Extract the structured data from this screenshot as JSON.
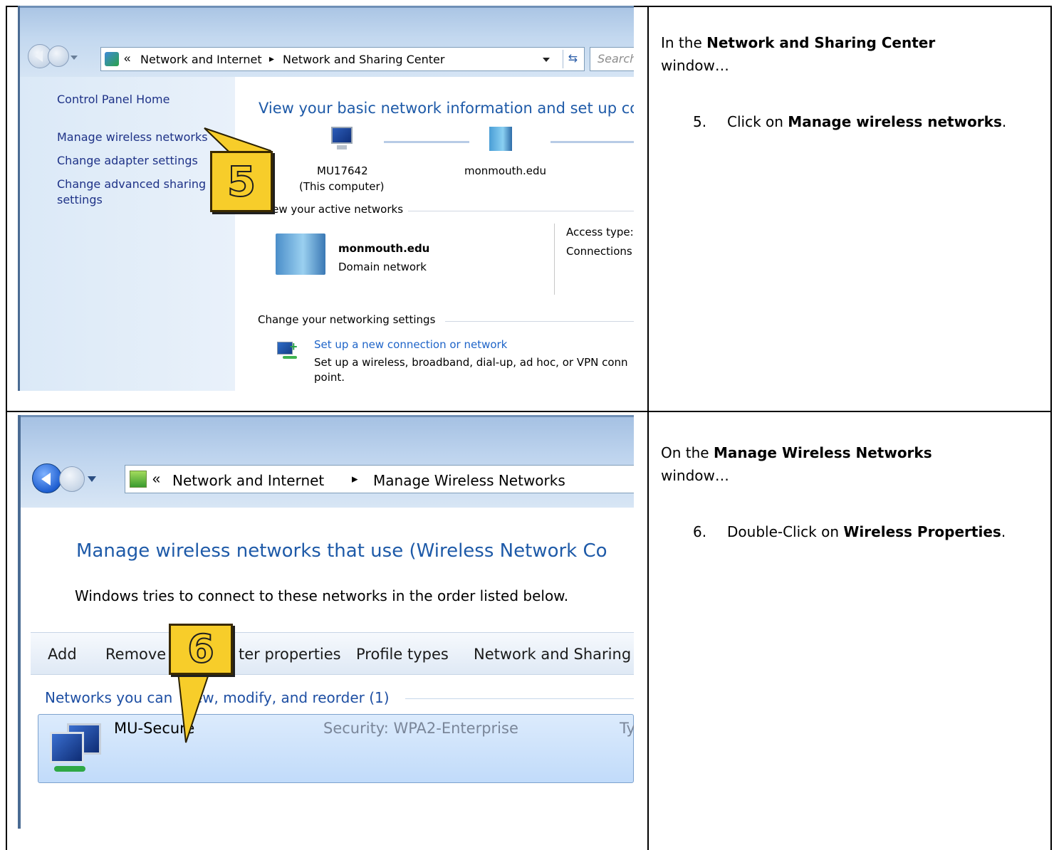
{
  "step5": {
    "window": {
      "address_root": "«",
      "crumb1": "Network and Internet",
      "crumb_sep": "▸",
      "crumb2": "Network and Sharing Center",
      "search_placeholder": "Search"
    },
    "sidebar": {
      "items": [
        {
          "label": "Control Panel Home"
        },
        {
          "label": "Manage wireless networks"
        },
        {
          "label": "Change adapter settings"
        },
        {
          "label": "Change advanced sharing"
        },
        {
          "label": "settings"
        }
      ]
    },
    "main": {
      "heading": "View your basic network information and set up con",
      "computer_name": "MU17642",
      "computer_sub": "(This computer)",
      "domain_name": "monmouth.edu",
      "active_networks_label": "iew your active networks",
      "network_name": "monmouth.edu",
      "network_type": "Domain network",
      "access_type_label": "Access type:",
      "connections_label": "Connections",
      "change_settings_label": "Change your networking settings",
      "setup_link": "Set up a new connection or network",
      "setup_desc_line1": "Set up a wireless, broadband, dial-up, ad hoc, or VPN conn",
      "setup_desc_line2": "point."
    },
    "badge": "5",
    "instructions": {
      "intro_before": "In the ",
      "intro_bold": "Network and Sharing Center",
      "intro_after": "window…",
      "step_number": "5.",
      "step_before": "Click on ",
      "step_bold": "Manage wireless networks",
      "step_after": "."
    }
  },
  "step6": {
    "window": {
      "address_root": "«",
      "crumb1": "Network and Internet",
      "crumb_sep": "▸",
      "crumb2": "Manage Wireless Networks"
    },
    "main": {
      "heading": "Manage wireless networks that use (Wireless Network Co",
      "subtitle": "Windows tries to connect to these networks in the order listed below.",
      "toolbar": [
        "Add",
        "Remove",
        "ter properties",
        "Profile types",
        "Network and Sharing"
      ],
      "group_label": "Networks you can view, modify, and reorder (1)",
      "group_label_visible_a": "Networks you can",
      "group_label_visible_b": "iew, modify, and reorder (1)",
      "network_name": "MU-Secure",
      "security": "Security:  WPA2-Enterprise",
      "type_fragment": "Ty"
    },
    "badge": "6",
    "instructions": {
      "intro_before": "On the ",
      "intro_bold": "Manage Wireless Networks",
      "intro_after": "window…",
      "step_number": "6.",
      "step_before": "Double-Click on ",
      "step_bold": "Wireless Properties",
      "step_after": "."
    }
  },
  "colors": {
    "badge_fill": "#f7cd2a",
    "link_blue": "#1e64c8",
    "heading_blue": "#1e5aa8",
    "chrome_blue": "#bcd3ee"
  }
}
